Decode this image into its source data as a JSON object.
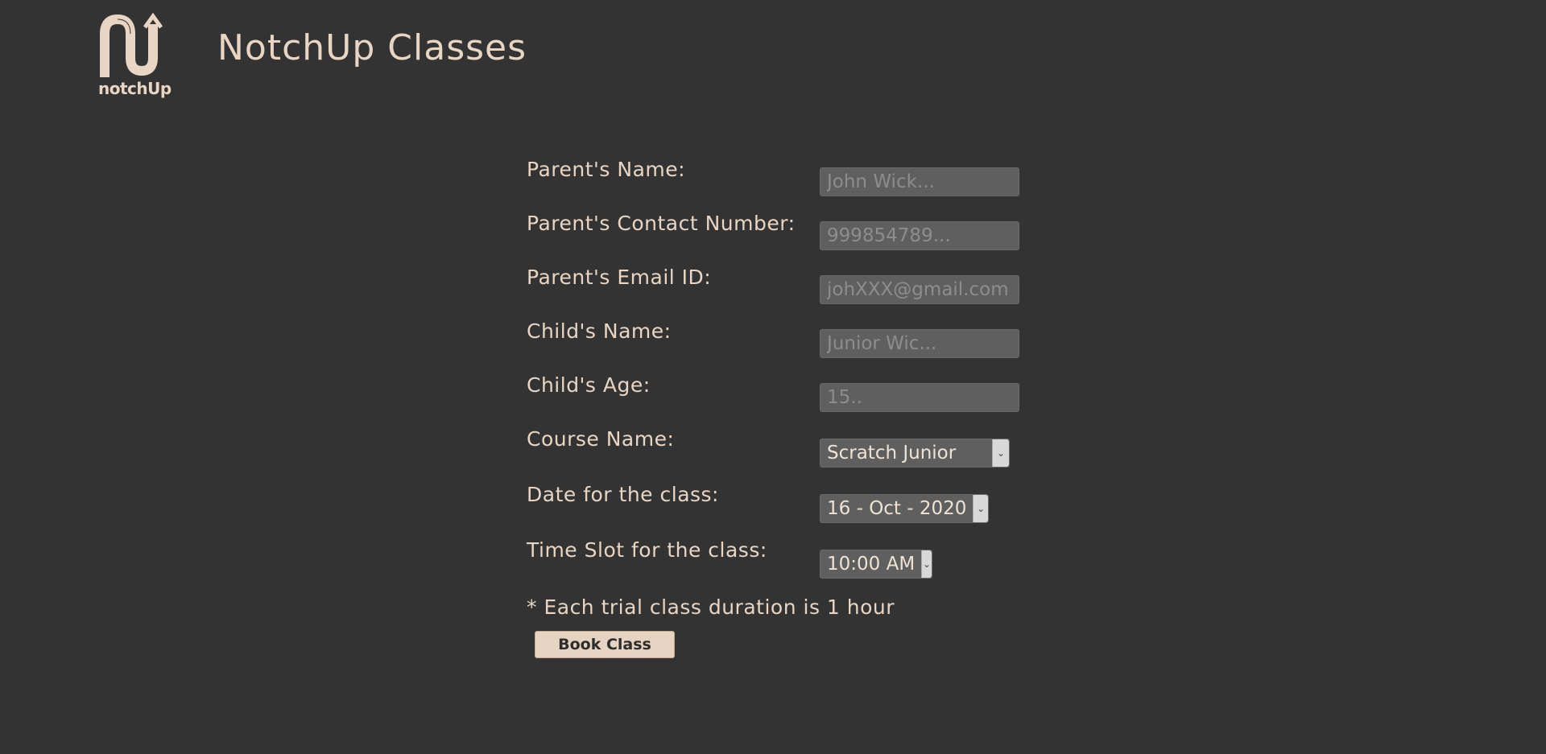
{
  "header": {
    "logo_text": "notchUp",
    "title": "NotchUp Classes"
  },
  "colors": {
    "background": "#333333",
    "text": "#e8d5c4",
    "input_bg": "#5f5f5f",
    "button_bg": "#e6d3c1"
  },
  "form": {
    "parent_name": {
      "label": "Parent's Name:",
      "placeholder": "John Wick...",
      "value": ""
    },
    "parent_contact": {
      "label": "Parent's Contact Number:",
      "placeholder": "999854789...",
      "value": ""
    },
    "parent_email": {
      "label": "Parent's Email ID:",
      "placeholder": "johXXX@gmail.com",
      "value": ""
    },
    "child_name": {
      "label": "Child's Name:",
      "placeholder": "Junior Wic...",
      "value": ""
    },
    "child_age": {
      "label": "Child's Age:",
      "placeholder": "15..",
      "value": ""
    },
    "course": {
      "label": "Course Name:",
      "selected": "Scratch Junior"
    },
    "date": {
      "label": "Date for the class:",
      "selected": "16 - Oct - 2020"
    },
    "time_slot": {
      "label": "Time Slot for the class:",
      "selected": "10:00 AM"
    },
    "note": "* Each trial class duration is 1 hour",
    "submit_label": "Book Class"
  }
}
